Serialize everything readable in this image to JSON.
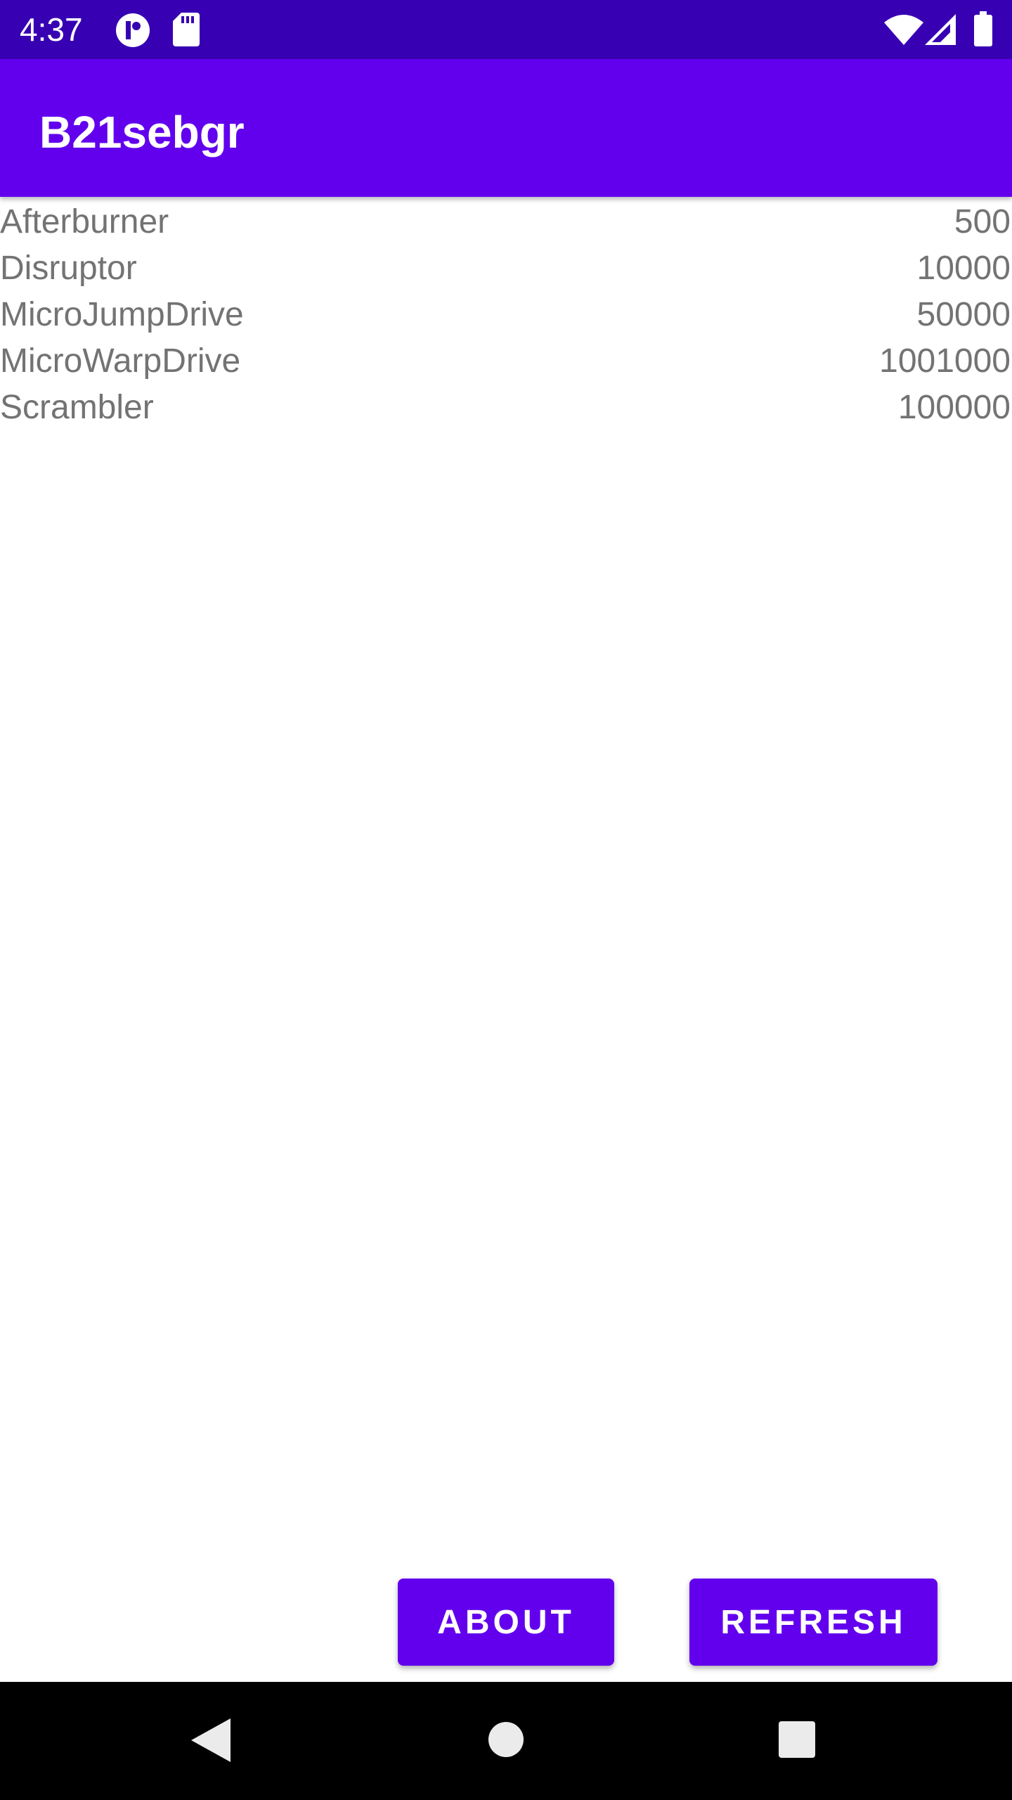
{
  "status_bar": {
    "time": "4:37",
    "icons": [
      "app-notification-icon",
      "sd-card-icon",
      "wifi-icon",
      "cell-signal-icon",
      "battery-icon"
    ],
    "background_color": "#3700b3"
  },
  "app_bar": {
    "title": "B21sebgr",
    "background_color": "#6200ee"
  },
  "items": [
    {
      "name": "Afterburner",
      "value": "500"
    },
    {
      "name": "Disruptor",
      "value": "10000"
    },
    {
      "name": "MicroJumpDrive",
      "value": "50000"
    },
    {
      "name": "MicroWarpDrive",
      "value": "1001000"
    },
    {
      "name": "Scrambler",
      "value": "100000"
    }
  ],
  "buttons": {
    "about_label": "ABOUT",
    "refresh_label": "REFRESH",
    "color": "#6200ee"
  },
  "nav_bar": {
    "icons": [
      "back-icon",
      "home-icon",
      "recents-icon"
    ]
  }
}
